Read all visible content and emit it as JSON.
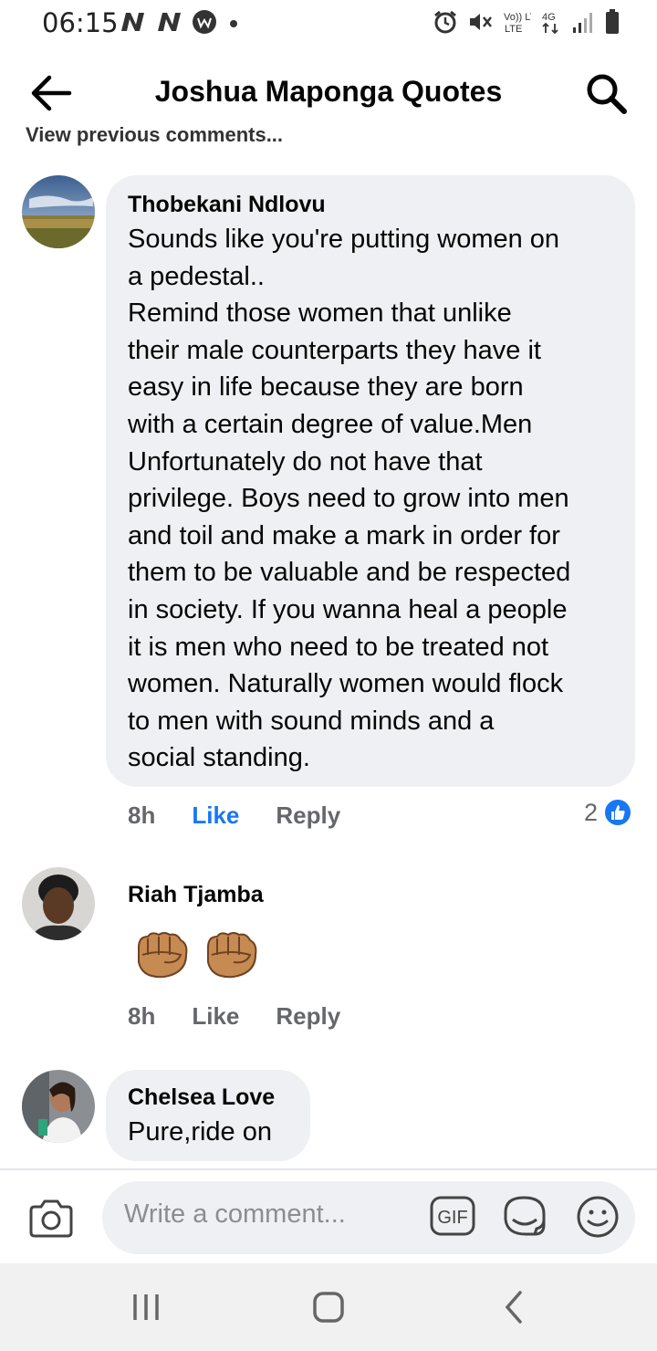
{
  "status_bar": {
    "time": "06:15",
    "left_icons": [
      "n-notification-icon",
      "n-notification-icon",
      "w-app-icon",
      "dot-icon"
    ],
    "right_icons": [
      "alarm-icon",
      "mute-icon",
      "volte-icon",
      "4g-icon",
      "signal-icon",
      "battery-icon"
    ],
    "volte_label": "Vo)) LTE",
    "network_label": "4G"
  },
  "header": {
    "title": "Joshua Maponga Quotes"
  },
  "prev_comments_label": "View previous comments...",
  "comments": [
    {
      "author": "Thobekani Ndlovu",
      "text": "Sounds like you're putting women on\na pedestal..\nRemind those women that unlike\ntheir male counterparts they have it\neasy in life because they are born\nwith a certain degree of value.Men\nUnfortunately do not have that\nprivilege. Boys need to grow into men\nand toil and make a mark in order for\nthem to be valuable and be respected\nin society. If you wanna heal a people\nit is men who need to be treated not\nwomen. Naturally women would flock\nto men with sound minds and a\nsocial standing.",
      "time": "8h",
      "like_label": "Like",
      "reply_label": "Reply",
      "reaction_count": "2",
      "liked": true
    },
    {
      "author": "Riah Tjamba",
      "text": "",
      "emojis": [
        "fist-emoji",
        "fist-emoji"
      ],
      "time": "8h",
      "like_label": "Like",
      "reply_label": "Reply"
    },
    {
      "author": "Chelsea Love",
      "text": "Pure,ride on"
    }
  ],
  "composer": {
    "placeholder": "Write a comment...",
    "gif_label": "GIF"
  },
  "colors": {
    "accent": "#1877f2",
    "bubble": "#eff0f3",
    "secondary_text": "#65676b",
    "emoji_skin": "#c68a53"
  }
}
